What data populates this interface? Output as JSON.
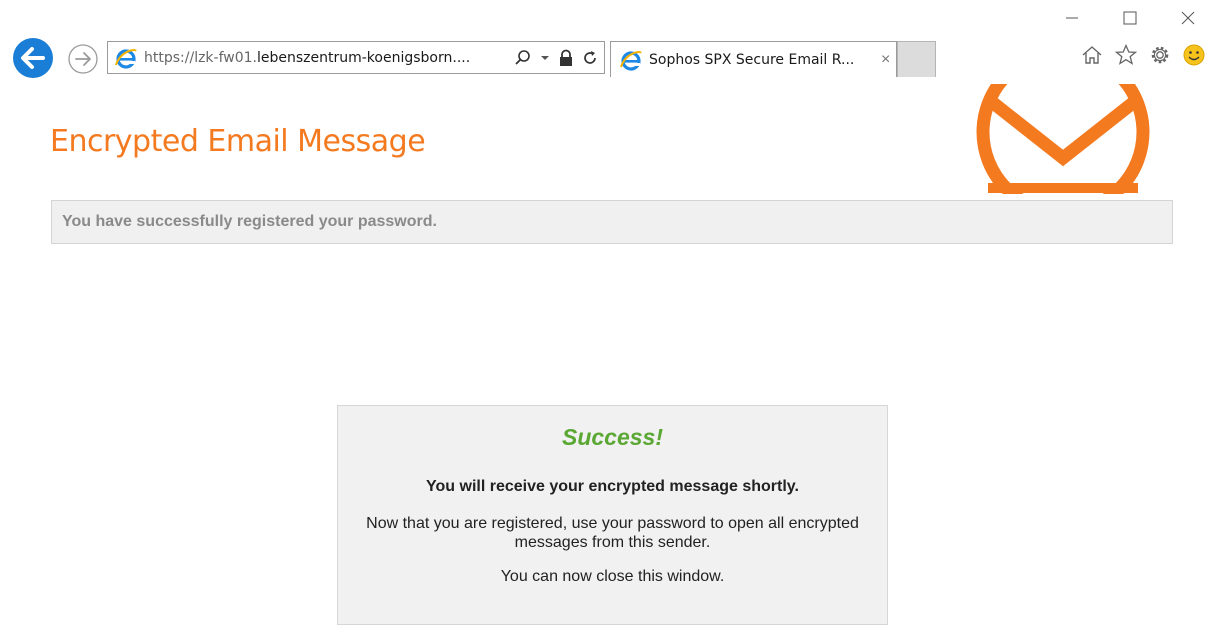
{
  "browser": {
    "address": {
      "url_scheme": "https://",
      "url_host_prefix": "lzk-fw01.",
      "url_host_main": "lebenszentrum-koenigsborn....",
      "search_icon": "search-icon",
      "dropdown_icon": "chevron-down-icon",
      "lock_icon": "lock-icon",
      "refresh_icon": "refresh-icon"
    },
    "tab": {
      "title": "Sophos SPX Secure Email R...",
      "close": "×"
    },
    "toolbar": {
      "home_icon": "home-icon",
      "favorites_icon": "star-icon",
      "settings_icon": "gear-icon",
      "feedback_icon": "smiley-icon"
    },
    "window": {
      "minimize": "—",
      "maximize": "☐",
      "close": "✕"
    }
  },
  "page": {
    "heading": "Encrypted Email Message",
    "notice": "You have successfully registered your password.",
    "success": {
      "title": "Success!",
      "line1": "You will receive your encrypted message shortly.",
      "line2": "Now that you are registered, use your password to open all encrypted messages from this sender.",
      "line3": "You can now close this window."
    }
  },
  "colors": {
    "brand_orange": "#f47a20",
    "success_green": "#5aa833",
    "back_button_blue": "#1b7ed6"
  }
}
